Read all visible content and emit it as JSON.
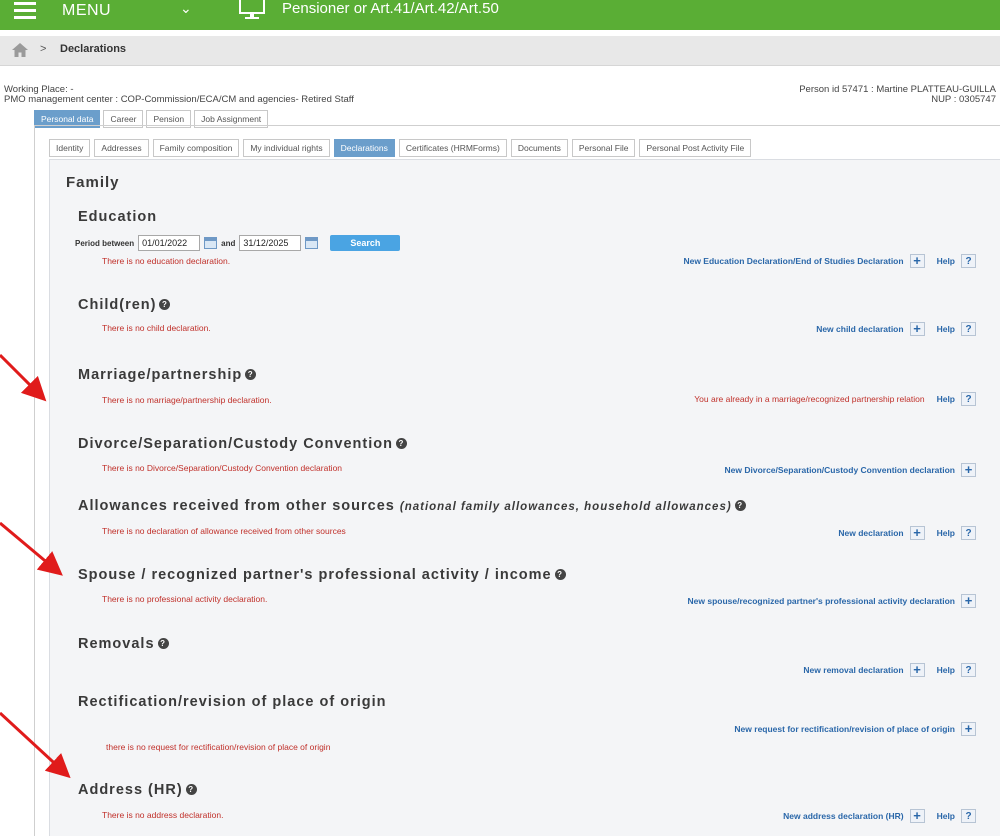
{
  "topbar": {
    "menu_label": "MENU",
    "status_label": "Pensioner or Art.41/Art.42/Art.50"
  },
  "breadcrumb": {
    "separator": ">",
    "current": "Declarations"
  },
  "header": {
    "working_place": "Working Place: -",
    "pmo_center": "PMO management center : COP-Commission/ECA/CM and agencies- Retired Staff",
    "person": "Person id 57471 : Martine PLATTEAU-GUILLA",
    "nup": "NUP : 0305747"
  },
  "main_tabs": [
    {
      "label": "Personal data",
      "active": true
    },
    {
      "label": "Career",
      "active": false
    },
    {
      "label": "Pension",
      "active": false
    },
    {
      "label": "Job Assignment",
      "active": false
    }
  ],
  "sub_tabs": [
    {
      "label": "Identity",
      "active": false
    },
    {
      "label": "Addresses",
      "active": false
    },
    {
      "label": "Family composition",
      "active": false
    },
    {
      "label": "My individual rights",
      "active": false
    },
    {
      "label": "Declarations",
      "active": true
    },
    {
      "label": "Certificates (HRMForms)",
      "active": false
    },
    {
      "label": "Documents",
      "active": false
    },
    {
      "label": "Personal File",
      "active": false
    },
    {
      "label": "Personal Post Activity File",
      "active": false
    }
  ],
  "family_title": "Family",
  "period": {
    "label_between": "Period between",
    "from": "01/01/2022",
    "label_and": "and",
    "to": "31/12/2025",
    "search_label": "Search"
  },
  "help_label": "Help",
  "sections": {
    "education": {
      "title": "Education",
      "message": "There is no education declaration.",
      "action": "New Education Declaration/End of Studies Declaration"
    },
    "children": {
      "title": "Child(ren)",
      "message": "There is no child declaration.",
      "action": "New child declaration"
    },
    "marriage": {
      "title": "Marriage/partnership",
      "message": "There is no marriage/partnership declaration.",
      "warning": "You are already in a marriage/recognized partnership relation"
    },
    "divorce": {
      "title": "Divorce/Separation/Custody Convention",
      "message": "There is no Divorce/Separation/Custody Convention declaration",
      "action": "New Divorce/Separation/Custody Convention declaration"
    },
    "allowances": {
      "title": "Allowances received from other sources",
      "note": "(national family allowances, household allowances)",
      "message": "There is no declaration of allowance received from other sources",
      "action": "New declaration"
    },
    "spouse": {
      "title": "Spouse / recognized partner's professional activity / income",
      "message": "There is no professional activity declaration.",
      "action": "New spouse/recognized partner's professional activity declaration"
    },
    "removals": {
      "title": "Removals",
      "action": "New removal declaration"
    },
    "rectification": {
      "title": "Rectification/revision of place of origin",
      "action": "New request for rectification/revision of place of origin",
      "message": "there is no request for rectification/revision of place of origin"
    },
    "address": {
      "title": "Address (HR)",
      "message": "There is no address declaration.",
      "action": "New address declaration (HR)"
    }
  },
  "colors": {
    "topbar": "#5aae35",
    "active_tab": "#6b9ecb",
    "error_text": "#c0302a",
    "link_text": "#2a67a9",
    "arrow": "#e01b1b"
  }
}
